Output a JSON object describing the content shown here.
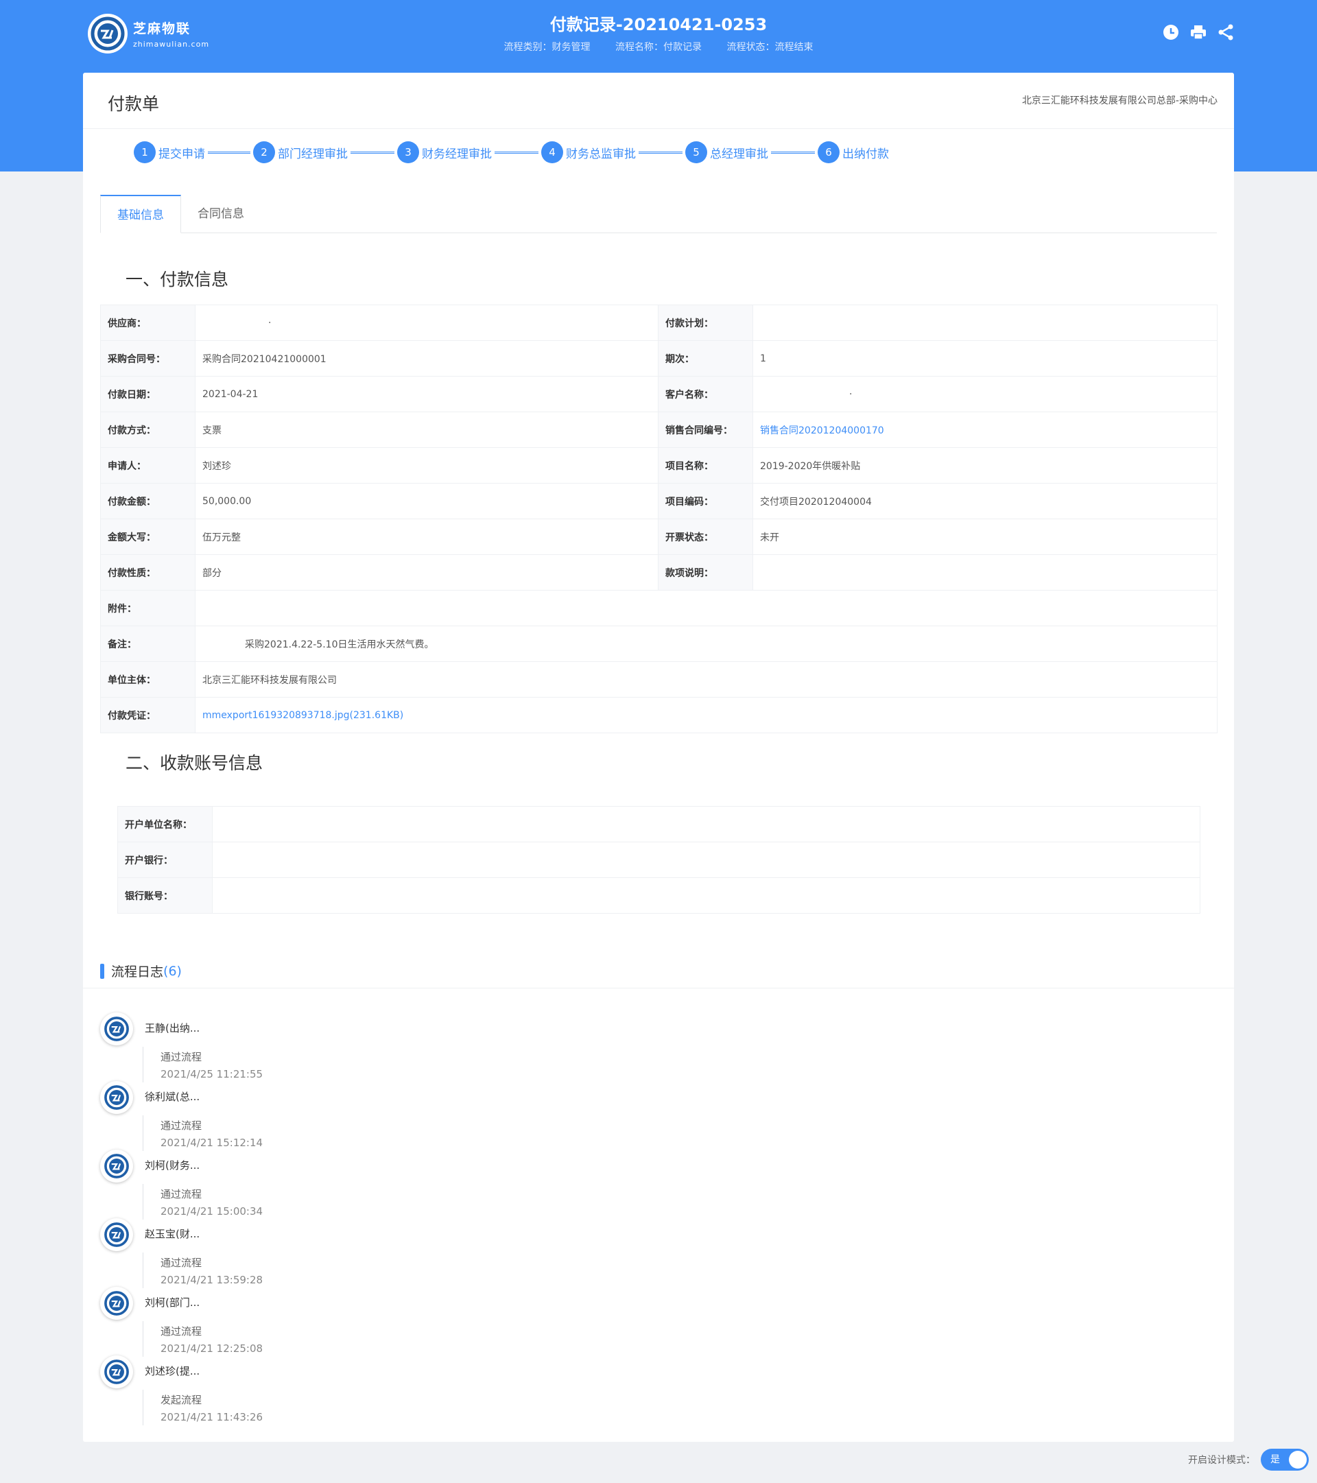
{
  "header": {
    "logo_cn": "芝麻物联",
    "logo_en": "zhimawulian.com",
    "title": "付款记录-20210421-0253",
    "meta": [
      "流程类别：财务管理",
      "流程名称：付款记录",
      "流程状态：流程结束"
    ],
    "icons": [
      "history-icon",
      "print-icon",
      "share-icon"
    ]
  },
  "card": {
    "title": "付款单",
    "org": "北京三汇能环科技发展有限公司总部-采购中心"
  },
  "steps": [
    {
      "num": "1",
      "label": "提交申请"
    },
    {
      "num": "2",
      "label": "部门经理审批"
    },
    {
      "num": "3",
      "label": "财务经理审批"
    },
    {
      "num": "4",
      "label": "财务总监审批"
    },
    {
      "num": "5",
      "label": "总经理审批"
    },
    {
      "num": "6",
      "label": "出纳付款"
    }
  ],
  "tabs": [
    {
      "label": "基础信息",
      "active": true
    },
    {
      "label": "合同信息",
      "active": false
    }
  ],
  "section1": {
    "title": "一、付款信息",
    "rows": [
      {
        "l1": "供应商：",
        "v1": "·",
        "l2": "付款计划：",
        "v2": ""
      },
      {
        "l1": "采购合同号：",
        "v1": "采购合同20210421000001",
        "l2": "期次：",
        "v2": "1"
      },
      {
        "l1": "付款日期：",
        "v1": "2021-04-21",
        "l2": "客户名称：",
        "v2": "·"
      },
      {
        "l1": "付款方式：",
        "v1": "支票",
        "l2": "销售合同编号：",
        "v2": "销售合同20201204000170"
      },
      {
        "l1": "申请人：",
        "v1": "刘述珍",
        "l2": "项目名称：",
        "v2": "2019-2020年供暖补贴"
      },
      {
        "l1": "付款金额：",
        "v1": "50,000.00",
        "l2": "项目编码：",
        "v2": "交付项目202012040004"
      },
      {
        "l1": "金额大写：",
        "v1": "伍万元整",
        "l2": "开票状态：",
        "v2": "未开"
      },
      {
        "l1": "付款性质：",
        "v1": "部分",
        "l2": "款项说明：",
        "v2": ""
      }
    ],
    "attachment_label": "附件：",
    "attachment_value": "",
    "remark_label": "备注：",
    "remark_value": "采购2021.4.22-5.10日生活用水天然气费。",
    "entity_label": "单位主体：",
    "entity_value": "北京三汇能环科技发展有限公司",
    "voucher_label": "付款凭证：",
    "voucher_value": "mmexport1619320893718.jpg(231.61KB)"
  },
  "section2": {
    "title": "二、收款账号信息",
    "rows": [
      {
        "label": "开户单位名称：",
        "value": ""
      },
      {
        "label": "开户银行：",
        "value": ""
      },
      {
        "label": "银行账号：",
        "value": ""
      }
    ]
  },
  "log": {
    "title": "流程日志",
    "count_open": "(",
    "count": "6",
    "count_close": ")",
    "items": [
      {
        "name": "王静(出纳...",
        "action": "通过流程",
        "time": "2021/4/25 11:21:55"
      },
      {
        "name": "徐利斌(总...",
        "action": "通过流程",
        "time": "2021/4/21 15:12:14"
      },
      {
        "name": "刘柯(财务...",
        "action": "通过流程",
        "time": "2021/4/21 15:00:34"
      },
      {
        "name": "赵玉宝(财...",
        "action": "通过流程",
        "time": "2021/4/21 13:59:28"
      },
      {
        "name": "刘柯(部门...",
        "action": "通过流程",
        "time": "2021/4/21 12:25:08"
      },
      {
        "name": "刘述珍(提...",
        "action": "发起流程",
        "time": "2021/4/21 11:43:26"
      }
    ]
  },
  "design_mode": {
    "label": "开启设计模式：",
    "toggle": "是"
  },
  "colors": {
    "primary": "#3e8ef7",
    "background": "#eff1f4"
  }
}
